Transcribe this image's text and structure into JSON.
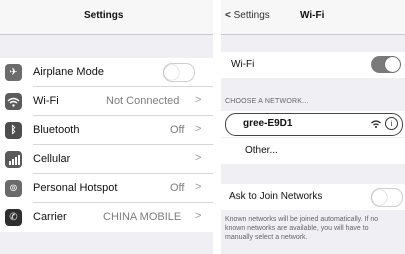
{
  "left": {
    "title": "Settings",
    "rows": [
      {
        "label": "Airplane Mode",
        "icon": "airplane-icon",
        "value": "",
        "chevron": "",
        "toggle": "off"
      },
      {
        "label": "Wi-Fi",
        "icon": "wifi-icon",
        "value": "Not Connected",
        "chevron": ">"
      },
      {
        "label": "Bluetooth",
        "icon": "bluetooth-icon",
        "value": "Off",
        "chevron": ">"
      },
      {
        "label": "Cellular",
        "icon": "cellular-icon",
        "value": "",
        "chevron": ">"
      },
      {
        "label": "Personal Hotspot",
        "icon": "hotspot-icon",
        "value": "Off",
        "chevron": ">"
      },
      {
        "label": "Carrier",
        "icon": "phone-icon",
        "value": "CHINA MOBILE",
        "chevron": ">"
      }
    ]
  },
  "right": {
    "back_chevron": "<",
    "back_label": "Settings",
    "title": "Wi-Fi",
    "wifi_label": "Wi-Fi",
    "wifi_toggle": "on",
    "choose_header": "CHOOSE A NETWORK...",
    "network_name": "gree-E9D1",
    "other_label": "Other...",
    "ask_label": "Ask to Join Networks",
    "ask_toggle": "off",
    "footer": "Known networks will be joined automatically. If no known networks are available, you will have to manually select a network."
  },
  "colors": {
    "background": "#efeff4",
    "toggle_on": "#7a7a7a"
  }
}
